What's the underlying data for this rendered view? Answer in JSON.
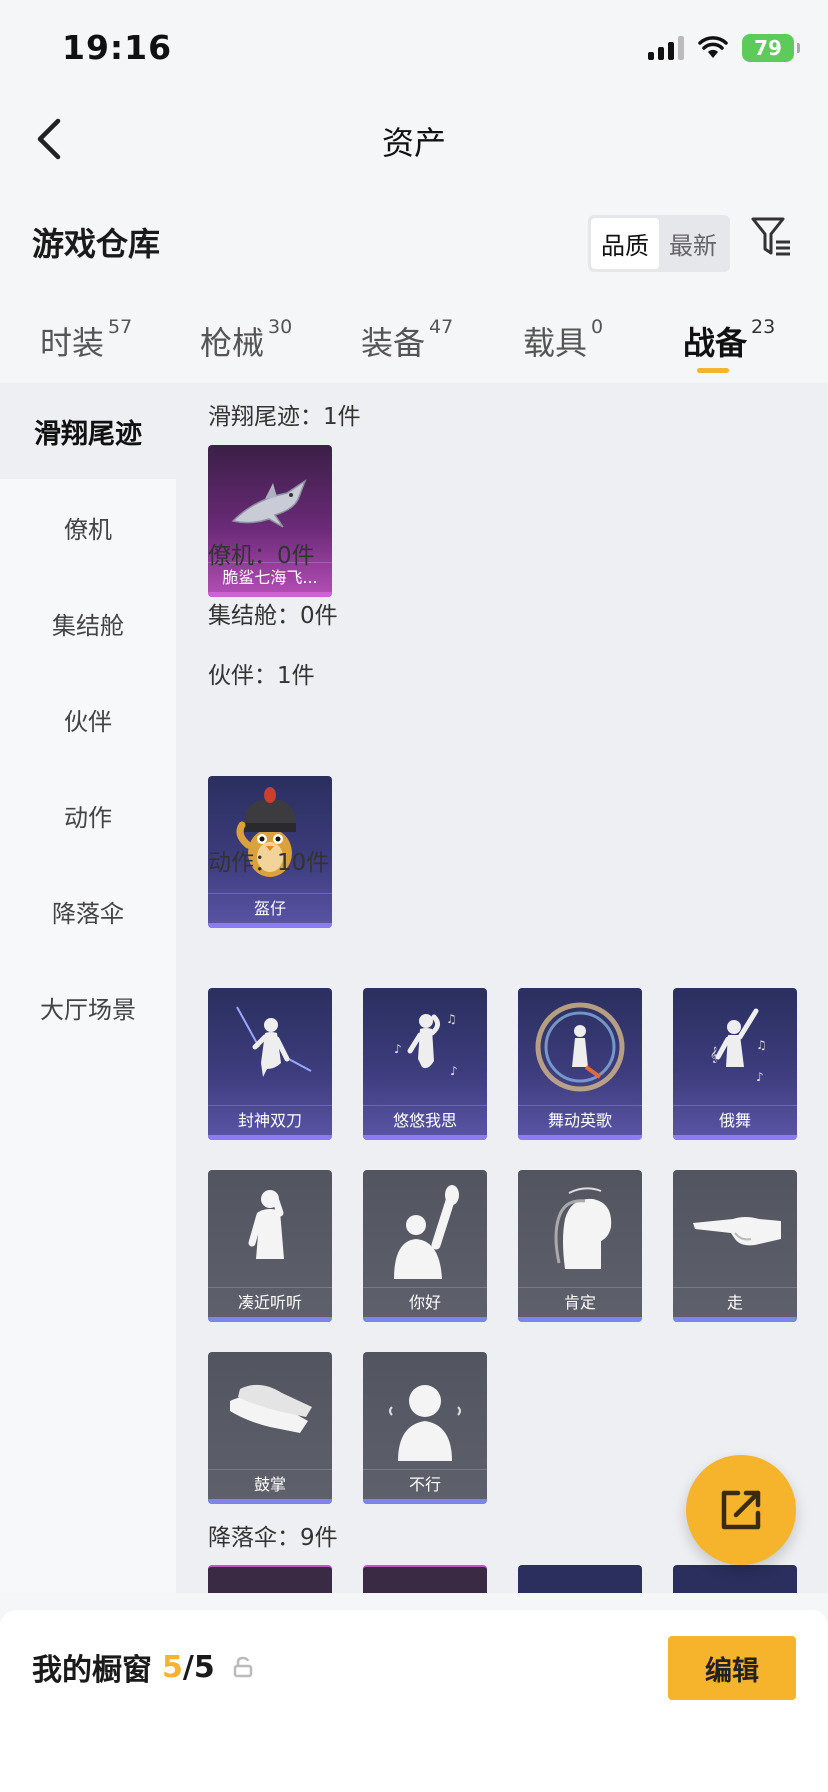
{
  "status_bar": {
    "time": "19:16",
    "battery": "79"
  },
  "nav": {
    "title": "资产"
  },
  "section": {
    "title": "游戏仓库"
  },
  "sort": {
    "options": [
      "品质",
      "最新"
    ],
    "active": "品质"
  },
  "tabs": [
    {
      "label": "时装",
      "count": "57"
    },
    {
      "label": "枪械",
      "count": "30"
    },
    {
      "label": "装备",
      "count": "47"
    },
    {
      "label": "载具",
      "count": "0"
    },
    {
      "label": "战备",
      "count": "23",
      "active": true
    }
  ],
  "sidebar": {
    "items": [
      "滑翔尾迹",
      "僚机",
      "集结舱",
      "伙伴",
      "动作",
      "降落伞",
      "大厅场景"
    ],
    "active": "滑翔尾迹"
  },
  "groups": [
    {
      "title": "滑翔尾迹：1件",
      "items": [
        {
          "label": "脆鲨七海飞...",
          "rarity": "pink"
        }
      ]
    },
    {
      "title": "僚机：0件",
      "items": []
    },
    {
      "title": "集结舱：0件",
      "items": []
    },
    {
      "title": "伙伴：1件",
      "items": [
        {
          "label": "盔仔",
          "rarity": "purple"
        }
      ]
    },
    {
      "title": "动作：10件",
      "items": [
        {
          "label": "封神双刀",
          "rarity": "purple"
        },
        {
          "label": "悠悠我思",
          "rarity": "purple"
        },
        {
          "label": "舞动英歌",
          "rarity": "purple"
        },
        {
          "label": "俄舞",
          "rarity": "purple"
        },
        {
          "label": "凑近听听",
          "rarity": "gray"
        },
        {
          "label": "你好",
          "rarity": "gray"
        },
        {
          "label": "肯定",
          "rarity": "gray"
        },
        {
          "label": "走",
          "rarity": "gray"
        },
        {
          "label": "鼓掌",
          "rarity": "gray"
        },
        {
          "label": "不行",
          "rarity": "gray"
        }
      ]
    },
    {
      "title": "降落伞：9件",
      "items": []
    }
  ],
  "showcase": {
    "title": "我的橱窗",
    "current": "5",
    "separator": "/",
    "total": "5",
    "edit_label": "编辑"
  },
  "colors": {
    "accent": "#f5b42b",
    "epic": "#d061d4",
    "rare": "#8b7df1",
    "common": "#7b86e9"
  }
}
